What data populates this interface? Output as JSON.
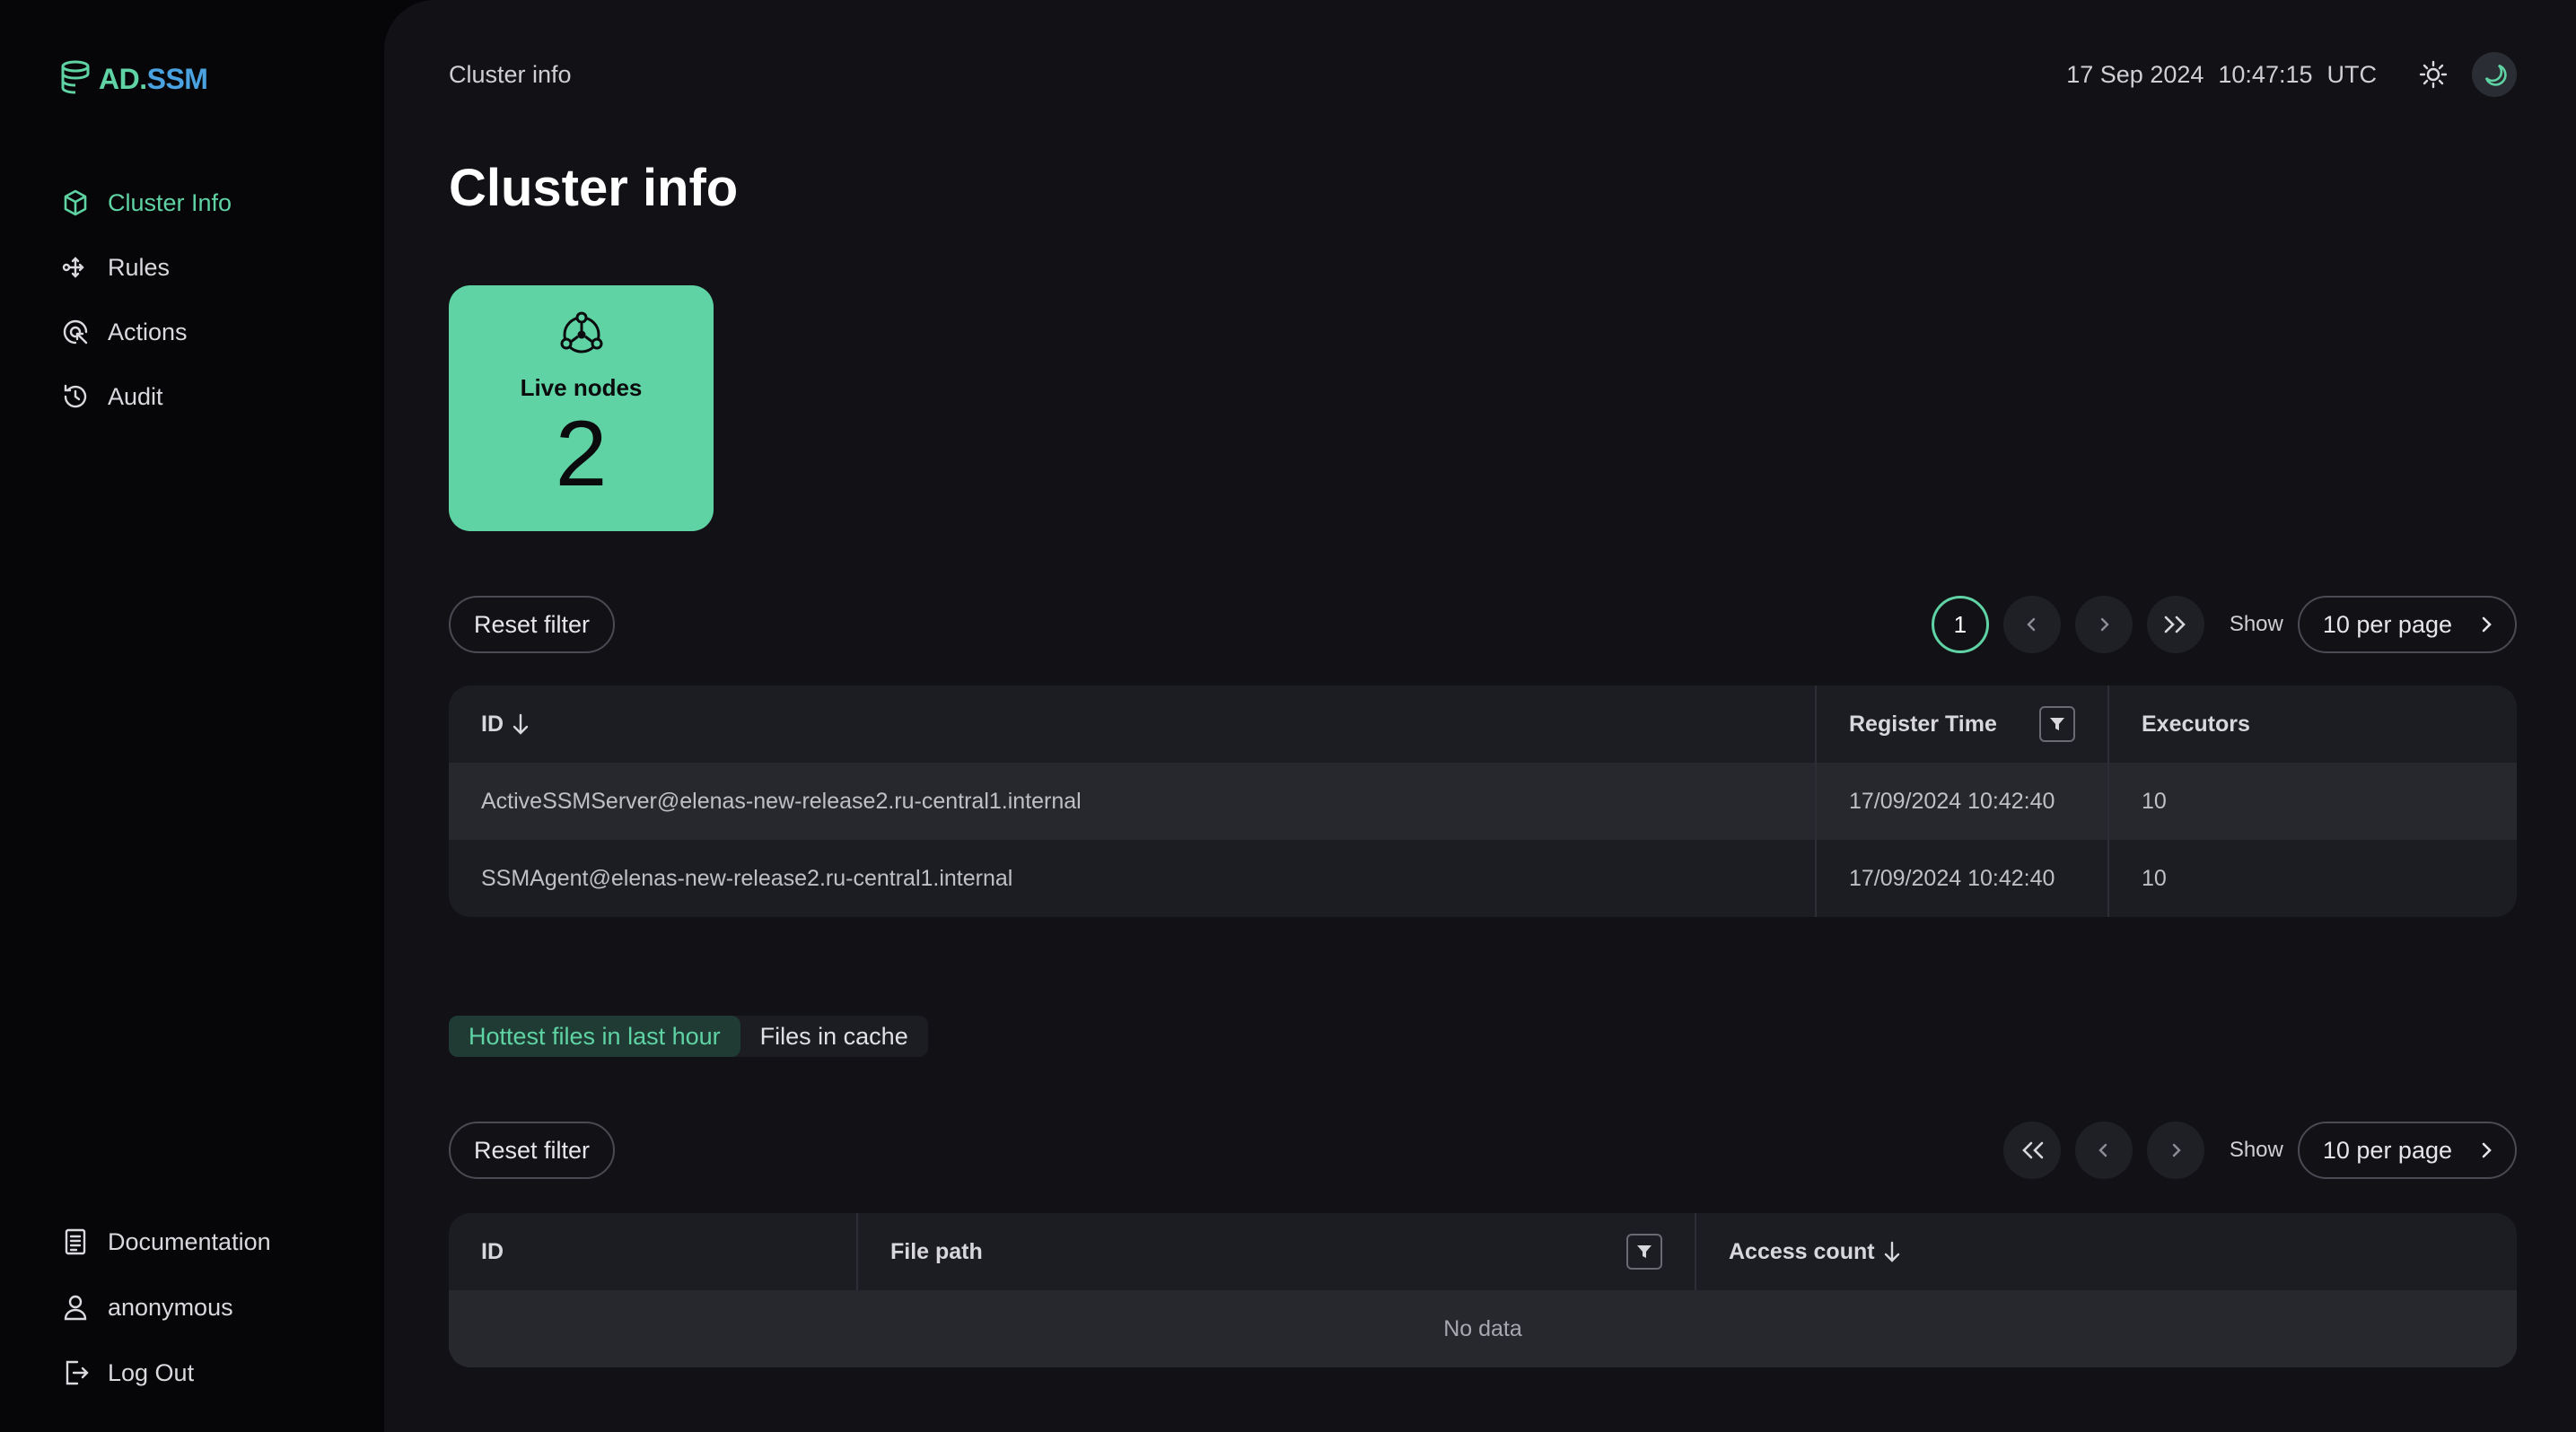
{
  "brand": {
    "logo_part1": "AD.",
    "logo_part2": "SSM"
  },
  "sidebar": {
    "items": [
      {
        "label": "Cluster Info",
        "icon": "box-icon",
        "active": true
      },
      {
        "label": "Rules",
        "icon": "flow-icon"
      },
      {
        "label": "Actions",
        "icon": "target-icon"
      },
      {
        "label": "Audit",
        "icon": "history-icon"
      }
    ],
    "bottom": [
      {
        "label": "Documentation",
        "icon": "document-icon"
      },
      {
        "label": "anonymous",
        "icon": "user-icon"
      },
      {
        "label": "Log Out",
        "icon": "logout-icon"
      }
    ]
  },
  "header": {
    "breadcrumb": "Cluster info",
    "date": "17 Sep 2024",
    "time": "10:47:15",
    "tz": "UTC"
  },
  "page": {
    "title": "Cluster info"
  },
  "live_nodes": {
    "label": "Live nodes",
    "count": "2"
  },
  "nodes_table": {
    "reset_label": "Reset filter",
    "pagination": {
      "current": "1",
      "show_label": "Show",
      "per_page": "10 per page"
    },
    "columns": {
      "id": "ID",
      "register_time": "Register Time",
      "executors": "Executors"
    },
    "rows": [
      {
        "id": "ActiveSSMServer@elenas-new-release2.ru-central1.internal",
        "register_time": "17/09/2024 10:42:40",
        "executors": "10"
      },
      {
        "id": "SSMAgent@elenas-new-release2.ru-central1.internal",
        "register_time": "17/09/2024 10:42:40",
        "executors": "10"
      }
    ]
  },
  "files": {
    "tabs": [
      "Hottest files in last hour",
      "Files in cache"
    ],
    "reset_label": "Reset filter",
    "pagination": {
      "show_label": "Show",
      "per_page": "10 per page"
    },
    "columns": {
      "id": "ID",
      "file_path": "File path",
      "access_count": "Access count"
    },
    "empty_text": "No data"
  },
  "colors": {
    "accent": "#5fd3a4",
    "brand_blue": "#4aa3e0",
    "background": "#111116"
  }
}
